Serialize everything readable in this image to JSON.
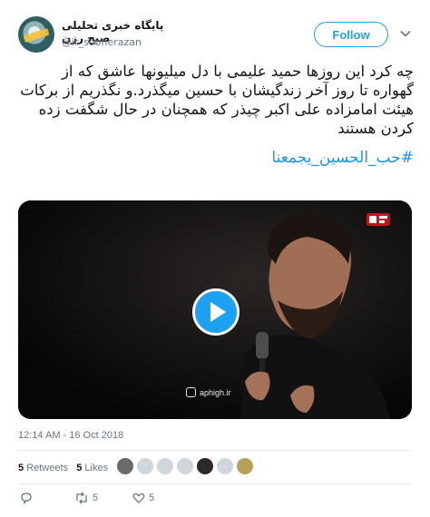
{
  "account": {
    "display_name": "پایگاه خبری تحلیلی صبح رزن",
    "handle": "@ir_sobherazan",
    "follow_label": "Follow"
  },
  "tweet": {
    "text": "چه کرد این روزها حمید علیمی با دل میلیونها عاشق که از گهواره تا روز آخر زندگیشان با حسین میگذرد.و نگذریم از برکات هیئت امامزاده علی اکبر چیذر که همچنان در حال شگفت زده کردن هستند",
    "hashtag": "#حب_الحسین_یجمعنا",
    "timestamp": "12:14 AM - 16 Oct 2018"
  },
  "video": {
    "watermark": "aphigh.ir"
  },
  "stats": {
    "retweets_count": "5",
    "retweets_label": "Retweets",
    "likes_count": "5",
    "likes_label": "Likes"
  },
  "actions": {
    "retweet_count": "5",
    "like_count": "5"
  },
  "colors": {
    "accent": "#1da1f2",
    "hashtag": "#1b95e0",
    "muted": "#657786"
  }
}
